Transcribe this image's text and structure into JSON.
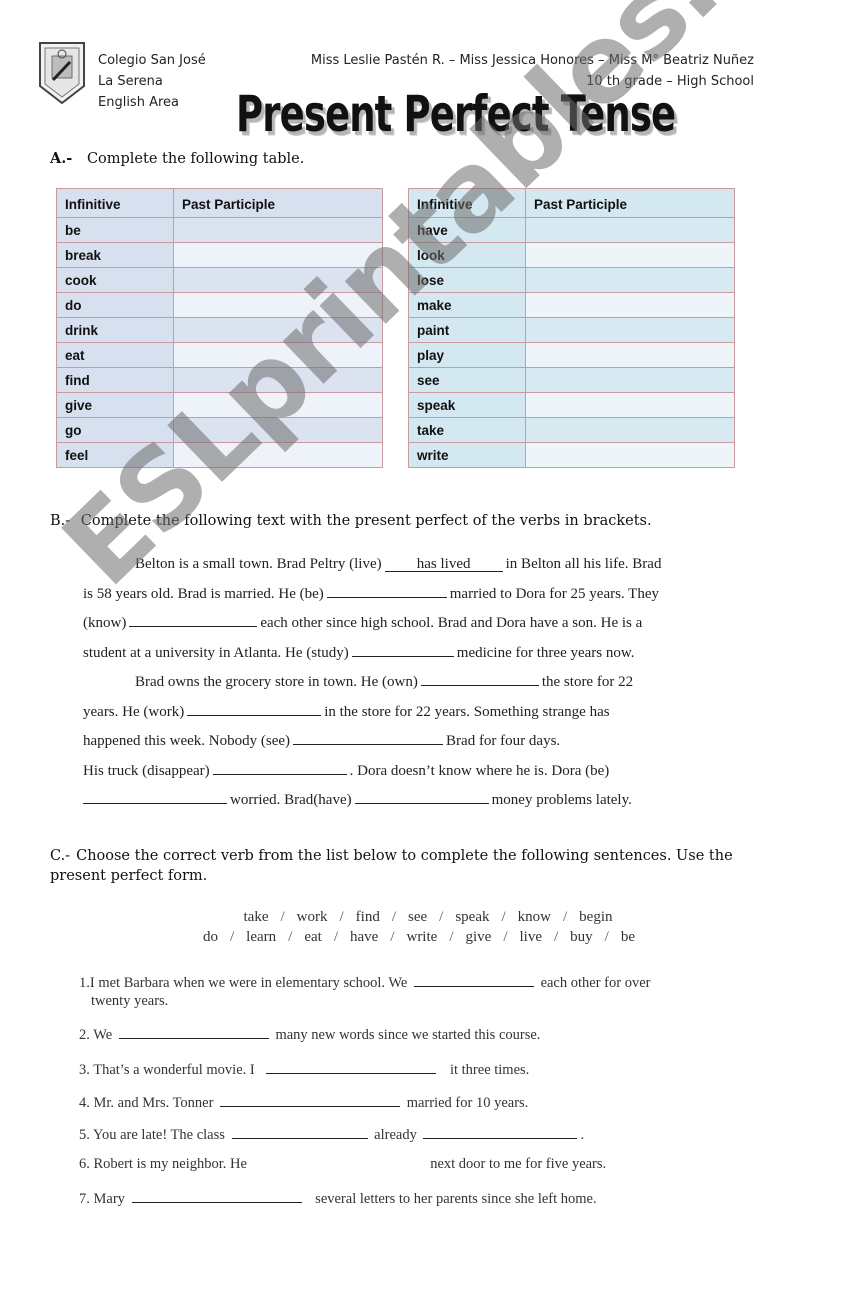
{
  "header": {
    "school_lines": [
      "Colegio San José",
      "La Serena",
      "English Area"
    ],
    "teachers": "Miss Leslie Pastén R.  – Miss Jessica Honores – Miss M° Beatriz Nuñez",
    "grade": "10 th grade – High School",
    "title": "Present Perfect Tense",
    "logo_icon": "school-crest-icon"
  },
  "section_a": {
    "letter": "A.-",
    "instruction": "Complete the following table.",
    "columns": [
      "Infinitive",
      "Past Participle"
    ],
    "left_table": [
      "be",
      "break",
      "cook",
      "do",
      "drink",
      "eat",
      "find",
      "give",
      "go",
      "feel"
    ],
    "right_table": [
      "have",
      "look",
      "lose",
      "make",
      "paint",
      "play",
      "see",
      "speak",
      "take",
      "write"
    ],
    "colors": {
      "left_header": "#d6e0ee",
      "right_header": "#d3e8f0",
      "border": "#c99aa2"
    }
  },
  "section_b": {
    "letter": "B.-",
    "instruction": "Complete the following text with the present perfect of the verbs in brackets.",
    "lines": [
      [
        "Belton is a small town. Brad Peltry (live)",
        "has lived",
        "in Belton all his life. Brad"
      ],
      [
        "is 58 years old. Brad is married. He (be)",
        "",
        "married to Dora for 25 years. They"
      ],
      [
        "(know)",
        "",
        "each other since high school. Brad and Dora have a son. He is a"
      ],
      [
        "student at a university in Atlanta. He (study)",
        "",
        "medicine for three years now."
      ],
      [
        "Brad owns the grocery store in town. He (own)",
        "",
        "the store for 22"
      ],
      [
        "years. He (work)",
        "",
        "in the store for 22 years. Something strange has"
      ],
      [
        "happened this week. Nobody (see)",
        "",
        "Brad for four days."
      ],
      [
        "His truck (disappear)",
        "",
        ". Dora doesn’t know where he is. Dora (be)"
      ],
      [
        "",
        "",
        "worried. Brad(have)",
        "",
        "money problems lately."
      ]
    ]
  },
  "section_c": {
    "letter": "C.-",
    "instruction": "Choose the correct verb from the list below to complete the following sentences. Use the present perfect form.",
    "verb_bank_row1": [
      "take",
      "work",
      "find",
      "see",
      "speak",
      "know",
      "begin"
    ],
    "verb_bank_row2": [
      "do",
      "learn",
      "eat",
      "have",
      "write",
      "give",
      "live",
      "buy",
      "be"
    ],
    "separator": "/",
    "sentences": [
      {
        "before": "1.I met Barbara when we were in elementary school. We",
        "after": "each other for over",
        "cont": "twenty years."
      },
      {
        "before": "2. We",
        "after": "many new words since we started this course."
      },
      {
        "before": "3. That’s a wonderful movie. I",
        "after": "it three times."
      },
      {
        "before": "4. Mr. and Mrs. Tonner",
        "after": "married for 10 years."
      },
      {
        "before": "5. You are late! The class",
        "middle": "already",
        "after": "."
      },
      {
        "before": "6. Robert is my neighbor. He",
        "after": "next door to me for five years."
      },
      {
        "before": "7. Mary",
        "after": "several letters to her parents since she left home."
      }
    ]
  },
  "watermark": "ESLprintables.com"
}
